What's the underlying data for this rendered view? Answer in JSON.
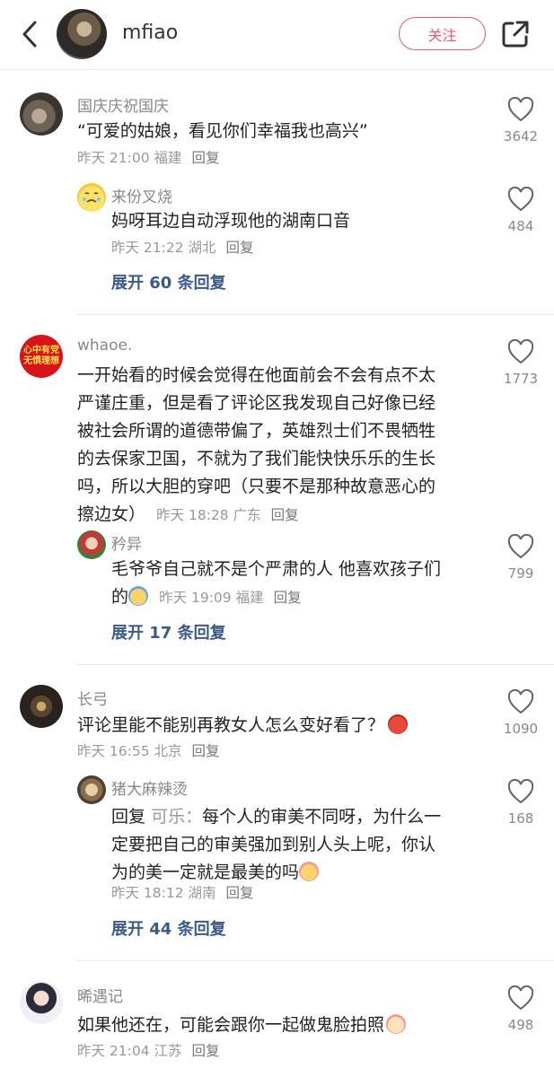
{
  "header": {
    "username": "mfiao",
    "follow_label": "关注"
  },
  "comments": [
    {
      "user": "国庆庆祝国庆",
      "text": "“可爱的姑娘，看见你们幸福我也高兴”",
      "time": "昨天 21:00",
      "location": "福建",
      "reply_label": "回复",
      "likes": "3642",
      "replies": [
        {
          "user": "来份叉烧",
          "text": "妈呀耳边自动浮现他的湖南口音",
          "time": "昨天 21:22",
          "location": "湖北",
          "reply_label": "回复",
          "likes": "484"
        }
      ],
      "expand": "展开 60 条回复"
    },
    {
      "user": "whaoe.",
      "avatar_text": "心中有党",
      "avatar_text2": "无惧理想",
      "text_lines": [
        "一开始看的时候会觉得在他面前会不会有点不太",
        "严谨庄重，但是看了评论区我发现自己好像已经",
        "被社会所谓的道德带偏了，英雄烈士们不畏牺牲",
        "的去保家卫国，不就为了我们能快快乐乐的生长",
        "吗，所以大胆的穿吧（只要不是那种故意恶心的"
      ],
      "text_last": "擦边女）",
      "time": "昨天 18:28",
      "location": "广东",
      "reply_label": "回复",
      "likes": "1773",
      "replies": [
        {
          "user": "矜异",
          "text": "毛爷爷自己就不是个严肃的人 他喜欢孩子们",
          "text_last": "的",
          "time": "昨天 19:09",
          "location": "福建",
          "reply_label": "回复",
          "likes": "799"
        }
      ],
      "expand": "展开 17 条回复"
    },
    {
      "user": "长弓",
      "text": "评论里能不能别再教女人怎么变好看了？",
      "time": "昨天 16:55",
      "location": "北京",
      "reply_label": "回复",
      "likes": "1090",
      "replies": [
        {
          "user": "猪大麻辣烫",
          "reply_prefix": "回复",
          "reply_target": "可乐：",
          "text": "每个人的审美不同呀，为什么一",
          "text_line2": "定要把自己的审美强加到别人头上呢，你认",
          "text_line3": "为的美一定就是最美的吗",
          "time": "昨天 18:12",
          "location": "湖南",
          "reply_label": "回复",
          "likes": "168"
        }
      ],
      "expand": "展开 44 条回复"
    },
    {
      "user": "晞遇记",
      "text": "如果他还在，可能会跟你一起做鬼脸拍照",
      "time": "昨天 21:04",
      "location": "江苏",
      "reply_label": "回复",
      "likes": "498"
    }
  ],
  "colors": {
    "accent": "#e85a78",
    "link": "#3a5a8a"
  }
}
